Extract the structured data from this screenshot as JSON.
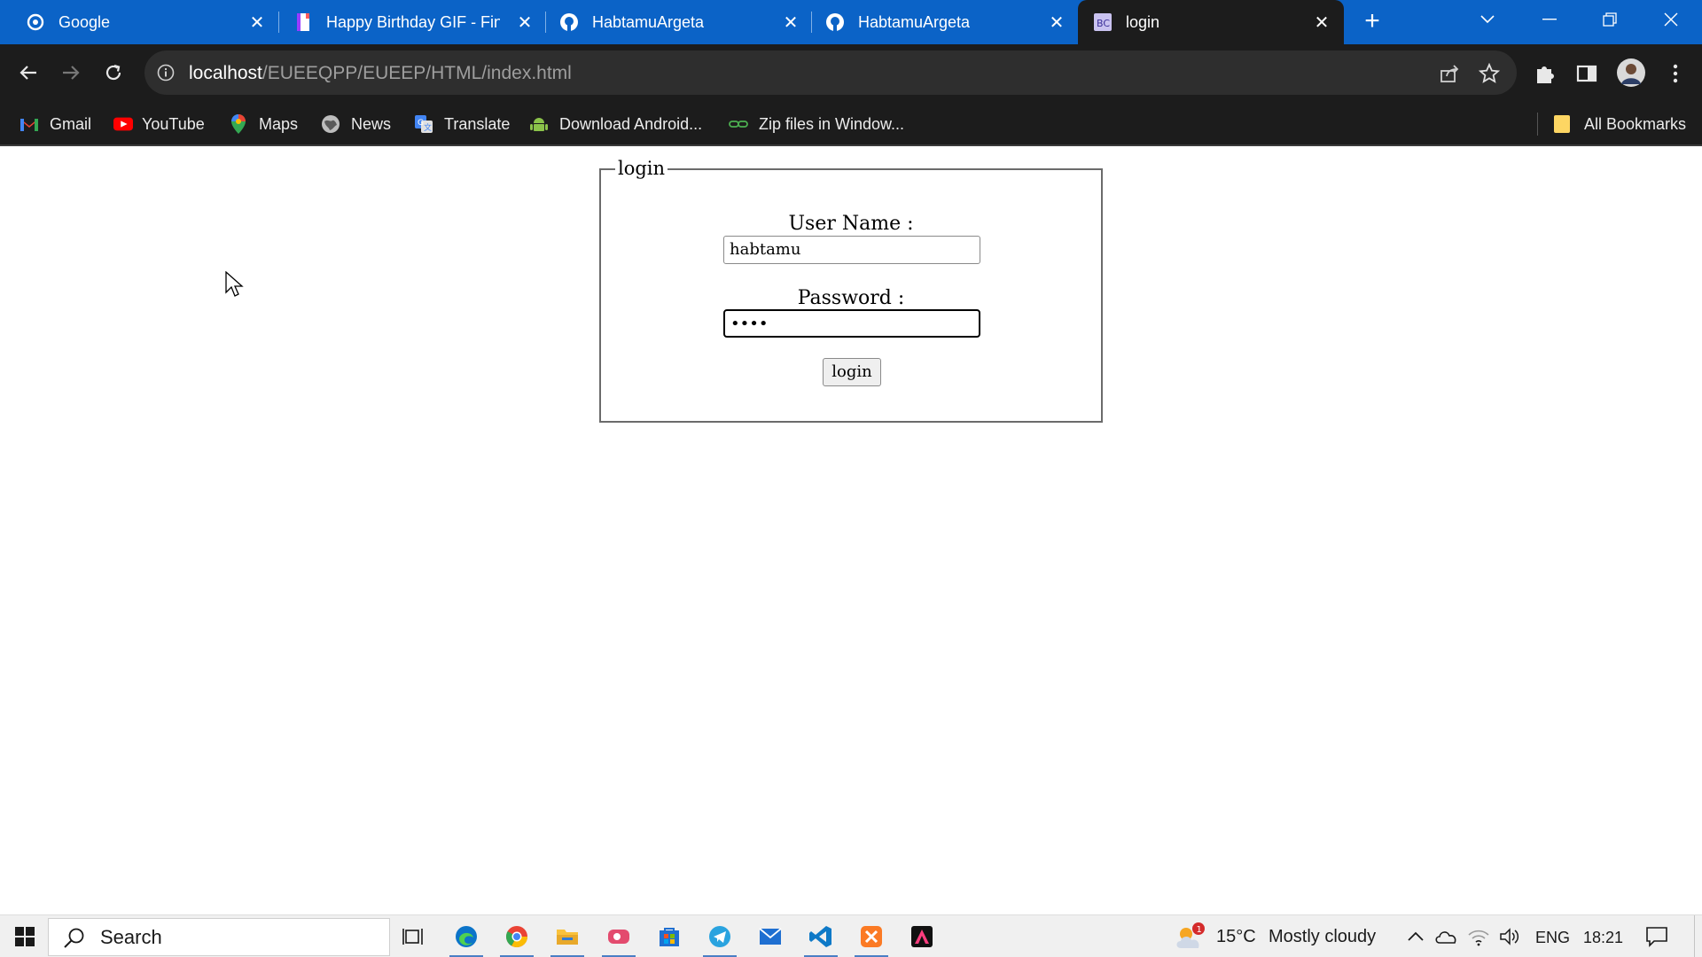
{
  "browser": {
    "tabs": [
      {
        "title": "Google",
        "icon": "google-icon"
      },
      {
        "title": "Happy Birthday GIF - Find",
        "icon": "giphy-icon"
      },
      {
        "title": "HabtamuArgeta",
        "icon": "github-icon"
      },
      {
        "title": "HabtamuArgeta",
        "icon": "github-icon"
      },
      {
        "title": "login",
        "icon": "page-icon"
      }
    ],
    "address_bar": {
      "host": "localhost",
      "path": "/EUEEQPP/EUEEP/HTML/index.html"
    },
    "bookmarks": [
      {
        "label": "Gmail",
        "icon": "gmail-icon"
      },
      {
        "label": "YouTube",
        "icon": "youtube-icon"
      },
      {
        "label": "Maps",
        "icon": "maps-icon"
      },
      {
        "label": "News",
        "icon": "news-icon"
      },
      {
        "label": "Translate",
        "icon": "translate-icon"
      },
      {
        "label": "Download Android...",
        "icon": "android-icon"
      },
      {
        "label": "Zip files in Window...",
        "icon": "link-icon"
      }
    ],
    "all_bookmarks_label": "All Bookmarks",
    "colors": {
      "tabbar": "#0b63c7",
      "toolbar": "#1c1c1c"
    }
  },
  "login_form": {
    "legend": "login",
    "username_label": "User Name :",
    "username_value": "habtamu",
    "password_label": "Password :",
    "password_mask": "••••",
    "submit_label": "login"
  },
  "taskbar": {
    "search_label": "Search",
    "weather_temp": "15°C",
    "weather_desc": "Mostly cloudy",
    "weather_badge": "1",
    "language": "ENG",
    "time": "18:21"
  }
}
